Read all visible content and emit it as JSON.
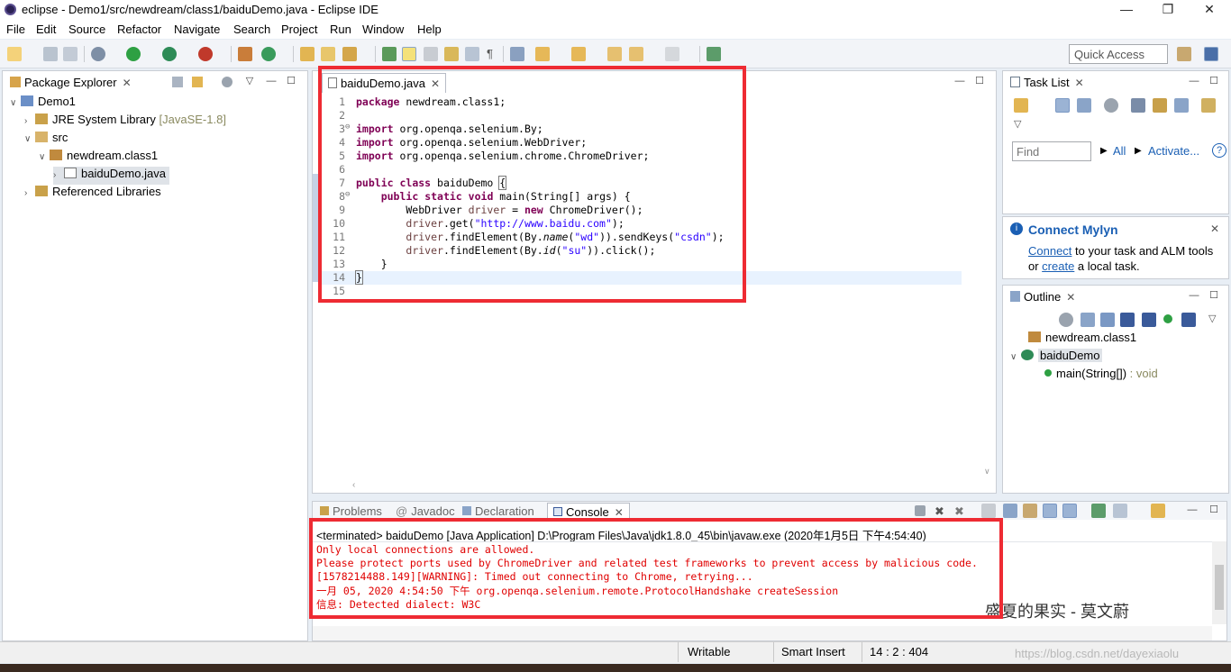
{
  "window": {
    "title": "eclipse - Demo1/src/newdream/class1/baiduDemo.java - Eclipse IDE"
  },
  "menu": [
    "File",
    "Edit",
    "Source",
    "Refactor",
    "Navigate",
    "Search",
    "Project",
    "Run",
    "Window",
    "Help"
  ],
  "toolbar": {
    "quick_access_placeholder": "Quick Access"
  },
  "package_explorer": {
    "tab_label": "Package Explorer",
    "items": [
      {
        "label": "Demo1"
      },
      {
        "label": "JRE System Library",
        "suffix": "[JavaSE-1.8]"
      },
      {
        "label": "src"
      },
      {
        "label": "newdream.class1"
      },
      {
        "label": "baiduDemo.java"
      },
      {
        "label": "Referenced Libraries"
      }
    ]
  },
  "editor": {
    "tab_label": "baiduDemo.java",
    "lines": [
      {
        "n": "1",
        "text": "package newdream.class1;"
      },
      {
        "n": "2",
        "text": ""
      },
      {
        "n": "3",
        "text": "import org.openqa.selenium.By;"
      },
      {
        "n": "4",
        "text": "import org.openqa.selenium.WebDriver;"
      },
      {
        "n": "5",
        "text": "import org.openqa.selenium.chrome.ChromeDriver;"
      },
      {
        "n": "6",
        "text": ""
      },
      {
        "n": "7",
        "text": "public class baiduDemo {"
      },
      {
        "n": "8",
        "text": "    public static void main(String[] args) {"
      },
      {
        "n": "9",
        "text": "        WebDriver driver = new ChromeDriver();"
      },
      {
        "n": "10",
        "text": "        driver.get(\"http://www.baidu.com\");"
      },
      {
        "n": "11",
        "text": "        driver.findElement(By.name(\"wd\")).sendKeys(\"csdn\");"
      },
      {
        "n": "12",
        "text": "        driver.findElement(By.id(\"su\")).click();"
      },
      {
        "n": "13",
        "text": "    }"
      },
      {
        "n": "14",
        "text": "}"
      },
      {
        "n": "15",
        "text": ""
      }
    ]
  },
  "task_list": {
    "tab_label": "Task List",
    "find_placeholder": "Find",
    "all_label": "All",
    "activate_label": "Activate..."
  },
  "mylyn": {
    "title": "Connect Mylyn",
    "connect": "Connect",
    "line1_rest": " to your task and ALM tools",
    "or": "or ",
    "create": "create",
    "line2_rest": " a local task."
  },
  "outline": {
    "tab_label": "Outline",
    "package": "newdream.class1",
    "class": "baiduDemo",
    "method": "main(String[])",
    "method_type": " : void"
  },
  "bottom_tabs": [
    "Problems",
    "Javadoc",
    "Declaration",
    "Console"
  ],
  "console": {
    "header": "<terminated> baiduDemo [Java Application] D:\\Program Files\\Java\\jdk1.8.0_45\\bin\\javaw.exe (2020年1月5日 下午4:54:40)",
    "lines": [
      "Only local connections are allowed.",
      "Please protect ports used by ChromeDriver and related test frameworks to prevent access by malicious code.",
      "[1578214488.149][WARNING]: Timed out connecting to Chrome, retrying...",
      "一月 05, 2020 4:54:50 下午 org.openqa.selenium.remote.ProtocolHandshake createSession",
      "信息: Detected dialect: W3C"
    ]
  },
  "status": {
    "writable": "Writable",
    "insert": "Smart Insert",
    "position": "14 : 2 : 404"
  },
  "watermark": {
    "author": "盛夏的果实 - 莫文蔚",
    "url": "https://blog.csdn.net/dayexiaolu"
  },
  "colors": {
    "annotation_red": "#ee2b33",
    "keyword": "#7f0055",
    "string": "#2a00ff",
    "console_error": "#e00000"
  }
}
